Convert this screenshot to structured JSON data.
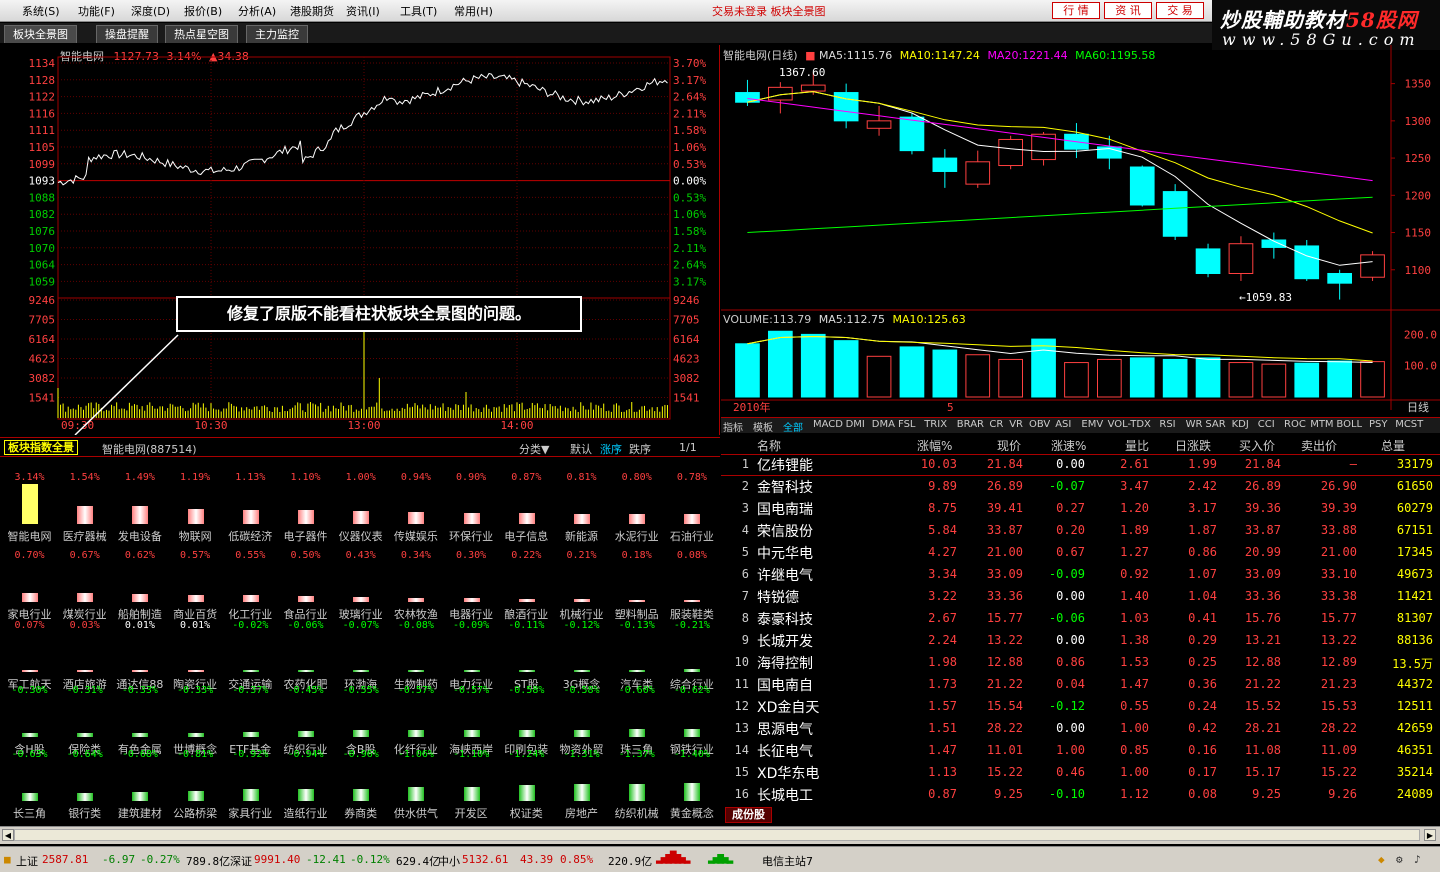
{
  "menu": {
    "items": [
      "系统(S)",
      "功能(F)",
      "深度(D)",
      "报价(B)",
      "分析(A)",
      "港股期货",
      "资讯(I)",
      "工具(T)",
      "常用(H)"
    ],
    "status_text": "交易未登录  板块全景图",
    "right_buttons": [
      "行 情",
      "资 讯",
      "交 易"
    ]
  },
  "logo": {
    "line1_a": "炒股輔助教材",
    "line1_b": "58",
    "line1_c": "股网",
    "line2": "www.58Gu.com"
  },
  "tabs": [
    "板块全景图",
    "操盘提醒",
    "热点星空图",
    "主力监控"
  ],
  "intraday": {
    "title": "智能电网",
    "price": "1127.73",
    "pct": "3.14%",
    "change": "▲34.38",
    "price_labels": [
      "1134",
      "1128",
      "1122",
      "1116",
      "1111",
      "1105",
      "1099",
      "1093",
      "1088",
      "1082",
      "1076",
      "1070",
      "1064",
      "1059"
    ],
    "pct_labels": [
      "3.70%",
      "3.17%",
      "2.64%",
      "2.11%",
      "1.58%",
      "1.06%",
      "0.53%",
      "0.00%",
      "0.53%",
      "1.06%",
      "1.58%",
      "2.11%",
      "2.64%",
      "3.17%"
    ],
    "vol_labels": [
      "9246",
      "7705",
      "6164",
      "4623",
      "3082",
      "1541"
    ],
    "time_labels": [
      "09:30",
      "10:30",
      "13:00",
      "14:00"
    ]
  },
  "callout": "修复了原版不能看柱状板块全景图的问题。",
  "kline": {
    "title": "智能电网(日线)",
    "ma5": "MA5:1115.76",
    "ma10": "MA10:1147.24",
    "ma20": "MA20:1221.44",
    "ma60": "MA60:1195.58",
    "high_label": "1367.60",
    "low_label": "←1059.83",
    "price_axis": [
      "1350",
      "1300",
      "1250",
      "1200",
      "1150",
      "1100"
    ],
    "vol_title": "VOLUME:113.79",
    "vol_ma5": "MA5:112.75",
    "vol_ma10": "MA10:125.63",
    "vol_axis": [
      "200.0",
      "100.0"
    ],
    "date_label": "2010年",
    "date_mark": "5",
    "period": "日线",
    "candles": [
      {
        "o": 1338,
        "h": 1355,
        "l": 1320,
        "c": 1325
      },
      {
        "o": 1328,
        "h": 1352,
        "l": 1310,
        "c": 1345
      },
      {
        "o": 1340,
        "h": 1365,
        "l": 1335,
        "c": 1348
      },
      {
        "o": 1338,
        "h": 1350,
        "l": 1290,
        "c": 1300
      },
      {
        "o": 1290,
        "h": 1320,
        "l": 1280,
        "c": 1300
      },
      {
        "o": 1305,
        "h": 1310,
        "l": 1255,
        "c": 1260
      },
      {
        "o": 1250,
        "h": 1262,
        "l": 1210,
        "c": 1232
      },
      {
        "o": 1215,
        "h": 1260,
        "l": 1210,
        "c": 1245
      },
      {
        "o": 1240,
        "h": 1280,
        "l": 1235,
        "c": 1275
      },
      {
        "o": 1248,
        "h": 1285,
        "l": 1240,
        "c": 1282
      },
      {
        "o": 1282,
        "h": 1297,
        "l": 1250,
        "c": 1262
      },
      {
        "o": 1265,
        "h": 1280,
        "l": 1235,
        "c": 1250
      },
      {
        "o": 1238,
        "h": 1240,
        "l": 1185,
        "c": 1187
      },
      {
        "o": 1205,
        "h": 1215,
        "l": 1140,
        "c": 1145
      },
      {
        "o": 1128,
        "h": 1135,
        "l": 1090,
        "c": 1095
      },
      {
        "o": 1095,
        "h": 1145,
        "l": 1085,
        "c": 1135
      },
      {
        "o": 1140,
        "h": 1150,
        "l": 1115,
        "c": 1130
      },
      {
        "o": 1132,
        "h": 1140,
        "l": 1085,
        "c": 1088
      },
      {
        "o": 1095,
        "h": 1100,
        "l": 1060,
        "c": 1082
      },
      {
        "o": 1090,
        "h": 1125,
        "l": 1085,
        "c": 1120
      }
    ],
    "volumes": [
      {
        "v": 170,
        "up": false
      },
      {
        "v": 210,
        "up": false
      },
      {
        "v": 200,
        "up": false
      },
      {
        "v": 180,
        "up": false
      },
      {
        "v": 130,
        "up": true
      },
      {
        "v": 160,
        "up": false
      },
      {
        "v": 150,
        "up": false
      },
      {
        "v": 135,
        "up": true
      },
      {
        "v": 120,
        "up": true
      },
      {
        "v": 185,
        "up": false
      },
      {
        "v": 110,
        "up": true
      },
      {
        "v": 120,
        "up": true
      },
      {
        "v": 125,
        "up": false
      },
      {
        "v": 120,
        "up": false
      },
      {
        "v": 125,
        "up": false
      },
      {
        "v": 110,
        "up": true
      },
      {
        "v": 105,
        "up": true
      },
      {
        "v": 108,
        "up": false
      },
      {
        "v": 115,
        "up": false
      },
      {
        "v": 113,
        "up": true
      }
    ]
  },
  "sector_header": {
    "tag": "板块指数全景",
    "name": "智能电网(887514)",
    "sort_menu": "分类▼",
    "opt_default": "默认",
    "opt_up": "涨序",
    "opt_down": "跌序",
    "page": "1/1"
  },
  "sectors": [
    [
      {
        "n": "智能电网",
        "p": "3.14%",
        "v": 3.14
      },
      {
        "n": "医疗器械",
        "p": "1.54%",
        "v": 1.54
      },
      {
        "n": "发电设备",
        "p": "1.49%",
        "v": 1.49
      },
      {
        "n": "物联网",
        "p": "1.19%",
        "v": 1.19
      },
      {
        "n": "低碳经济",
        "p": "1.13%",
        "v": 1.13
      },
      {
        "n": "电子器件",
        "p": "1.10%",
        "v": 1.1
      },
      {
        "n": "仪器仪表",
        "p": "1.00%",
        "v": 1.0
      },
      {
        "n": "传媒娱乐",
        "p": "0.94%",
        "v": 0.94
      },
      {
        "n": "环保行业",
        "p": "0.90%",
        "v": 0.9
      },
      {
        "n": "电子信息",
        "p": "0.87%",
        "v": 0.87
      },
      {
        "n": "新能源",
        "p": "0.81%",
        "v": 0.81
      },
      {
        "n": "水泥行业",
        "p": "0.80%",
        "v": 0.8
      },
      {
        "n": "石油行业",
        "p": "0.78%",
        "v": 0.78
      }
    ],
    [
      {
        "n": "家电行业",
        "p": "0.70%",
        "v": 0.7
      },
      {
        "n": "煤炭行业",
        "p": "0.67%",
        "v": 0.67
      },
      {
        "n": "船舶制造",
        "p": "0.62%",
        "v": 0.62
      },
      {
        "n": "商业百货",
        "p": "0.57%",
        "v": 0.57
      },
      {
        "n": "化工行业",
        "p": "0.55%",
        "v": 0.55
      },
      {
        "n": "食品行业",
        "p": "0.50%",
        "v": 0.5
      },
      {
        "n": "玻璃行业",
        "p": "0.43%",
        "v": 0.43
      },
      {
        "n": "农林牧渔",
        "p": "0.34%",
        "v": 0.34
      },
      {
        "n": "电器行业",
        "p": "0.30%",
        "v": 0.3
      },
      {
        "n": "酿酒行业",
        "p": "0.22%",
        "v": 0.22
      },
      {
        "n": "机械行业",
        "p": "0.21%",
        "v": 0.21
      },
      {
        "n": "塑料制品",
        "p": "0.18%",
        "v": 0.18
      },
      {
        "n": "服装鞋类",
        "p": "0.08%",
        "v": 0.08
      }
    ],
    [
      {
        "n": "军工航天",
        "p": "0.07%",
        "v": 0.07
      },
      {
        "n": "酒店旅游",
        "p": "0.03%",
        "v": 0.03
      },
      {
        "n": "通达信88",
        "p": "0.01%",
        "v": 0.01
      },
      {
        "n": "陶瓷行业",
        "p": "0.01%",
        "v": 0.01
      },
      {
        "n": "交通运输",
        "p": "-0.02%",
        "v": -0.02
      },
      {
        "n": "农药化肥",
        "p": "-0.06%",
        "v": -0.06
      },
      {
        "n": "环渤海",
        "p": "-0.07%",
        "v": -0.07
      },
      {
        "n": "生物制药",
        "p": "-0.08%",
        "v": -0.08
      },
      {
        "n": "电力行业",
        "p": "-0.09%",
        "v": -0.09
      },
      {
        "n": "ST股",
        "p": "-0.11%",
        "v": -0.11
      },
      {
        "n": "3G概念",
        "p": "-0.12%",
        "v": -0.12
      },
      {
        "n": "汽车类",
        "p": "-0.13%",
        "v": -0.13
      },
      {
        "n": "综合行业",
        "p": "-0.21%",
        "v": -0.21
      }
    ],
    [
      {
        "n": "含H股",
        "p": "-0.30%",
        "v": -0.3
      },
      {
        "n": "保险类",
        "p": "-0.31%",
        "v": -0.31
      },
      {
        "n": "有色金属",
        "p": "-0.33%",
        "v": -0.33
      },
      {
        "n": "世博概念",
        "p": "-0.33%",
        "v": -0.33
      },
      {
        "n": "ETF基金",
        "p": "-0.37%",
        "v": -0.37
      },
      {
        "n": "纺织行业",
        "p": "-0.45%",
        "v": -0.45
      },
      {
        "n": "含B股",
        "p": "-0.55%",
        "v": -0.55
      },
      {
        "n": "化纤行业",
        "p": "-0.57%",
        "v": -0.57
      },
      {
        "n": "海峡西岸",
        "p": "-0.57%",
        "v": -0.57
      },
      {
        "n": "印刷包装",
        "p": "-0.58%",
        "v": -0.58
      },
      {
        "n": "物资外贸",
        "p": "-0.58%",
        "v": -0.58
      },
      {
        "n": "珠三角",
        "p": "-0.60%",
        "v": -0.6
      },
      {
        "n": "钢铁行业",
        "p": "-0.62%",
        "v": -0.62
      }
    ],
    [
      {
        "n": "长三角",
        "p": "-0.63%",
        "v": -0.63
      },
      {
        "n": "银行类",
        "p": "-0.64%",
        "v": -0.64
      },
      {
        "n": "建筑建材",
        "p": "-0.68%",
        "v": -0.68
      },
      {
        "n": "公路桥梁",
        "p": "-0.81%",
        "v": -0.81
      },
      {
        "n": "家具行业",
        "p": "-0.92%",
        "v": -0.92
      },
      {
        "n": "造纸行业",
        "p": "-0.94%",
        "v": -0.94
      },
      {
        "n": "券商类",
        "p": "-0.96%",
        "v": -0.96
      },
      {
        "n": "供水供气",
        "p": "-1.06%",
        "v": -1.06
      },
      {
        "n": "开发区",
        "p": "-1.10%",
        "v": -1.1
      },
      {
        "n": "权证类",
        "p": "-1.24%",
        "v": -1.24
      },
      {
        "n": "房地产",
        "p": "-1.31%",
        "v": -1.31
      },
      {
        "n": "纺织机械",
        "p": "-1.37%",
        "v": -1.37
      },
      {
        "n": "黄金概念",
        "p": "-1.40%",
        "v": -1.4
      }
    ]
  ],
  "indicator_tabs": [
    "指标",
    "模板",
    "全部",
    "MACD",
    "DMI",
    "DMA",
    "FSL",
    "TRIX",
    "BRAR",
    "CR",
    "VR",
    "OBV",
    "ASI",
    "EMV",
    "VOL-TDX",
    "RSI",
    "WR",
    "SAR",
    "KDJ",
    "CCI",
    "ROC",
    "MTM",
    "BOLL",
    "PSY",
    "MCST"
  ],
  "table": {
    "headers": [
      "名称",
      "涨幅%",
      "现价",
      "涨速%",
      "量比",
      "日涨跌",
      "买入价",
      "卖出价",
      "总量"
    ],
    "rows": [
      [
        "1",
        "亿纬锂能",
        "10.03",
        "21.84",
        "0.00",
        "2.61",
        "1.99",
        "21.84",
        "—",
        "33179"
      ],
      [
        "2",
        "金智科技",
        "9.89",
        "26.89",
        "-0.07",
        "3.47",
        "2.42",
        "26.89",
        "26.90",
        "61650"
      ],
      [
        "3",
        "国电南瑞",
        "8.75",
        "39.41",
        "0.27",
        "1.20",
        "3.17",
        "39.36",
        "39.39",
        "60279"
      ],
      [
        "4",
        "荣信股份",
        "5.84",
        "33.87",
        "0.20",
        "1.89",
        "1.87",
        "33.87",
        "33.88",
        "67151"
      ],
      [
        "5",
        "中元华电",
        "4.27",
        "21.00",
        "0.67",
        "1.27",
        "0.86",
        "20.99",
        "21.00",
        "17345"
      ],
      [
        "6",
        "许继电气",
        "3.34",
        "33.09",
        "-0.09",
        "0.92",
        "1.07",
        "33.09",
        "33.10",
        "49673"
      ],
      [
        "7",
        "特锐德",
        "3.22",
        "33.36",
        "0.00",
        "1.40",
        "1.04",
        "33.36",
        "33.38",
        "11421"
      ],
      [
        "8",
        "泰豪科技",
        "2.67",
        "15.77",
        "-0.06",
        "1.03",
        "0.41",
        "15.76",
        "15.77",
        "81307"
      ],
      [
        "9",
        "长城开发",
        "2.24",
        "13.22",
        "0.00",
        "1.38",
        "0.29",
        "13.21",
        "13.22",
        "88136"
      ],
      [
        "10",
        "海得控制",
        "1.98",
        "12.88",
        "0.86",
        "1.53",
        "0.25",
        "12.88",
        "12.89",
        "13.5万"
      ],
      [
        "11",
        "国电南自",
        "1.73",
        "21.22",
        "0.04",
        "1.47",
        "0.36",
        "21.22",
        "21.23",
        "44372"
      ],
      [
        "12",
        "XD金自天",
        "1.57",
        "15.54",
        "-0.12",
        "0.55",
        "0.24",
        "15.52",
        "15.53",
        "12511"
      ],
      [
        "13",
        "思源电气",
        "1.51",
        "28.22",
        "0.00",
        "1.00",
        "0.42",
        "28.21",
        "28.22",
        "42659"
      ],
      [
        "14",
        "长征电气",
        "1.47",
        "11.01",
        "1.00",
        "0.85",
        "0.16",
        "11.08",
        "11.09",
        "46351"
      ],
      [
        "15",
        "XD华东电",
        "1.13",
        "15.22",
        "0.46",
        "1.00",
        "0.17",
        "15.17",
        "15.22",
        "35214"
      ],
      [
        "16",
        "长城电工",
        "0.87",
        "9.25",
        "-0.10",
        "1.12",
        "0.08",
        "9.25",
        "9.26",
        "24089"
      ]
    ],
    "footer_tab": "成份股"
  },
  "statusbar": {
    "sh_label": "上证",
    "sh_val": "2587.81",
    "sh_chg": "-6.97",
    "sh_pct": "-0.27%",
    "sh_amt": "789.8亿",
    "sz_label": "深证",
    "sz_val": "9991.40",
    "sz_chg": "-12.41",
    "sz_pct": "-0.12%",
    "sz_amt": "629.4亿",
    "zx_label": "中小",
    "zx_val": "5132.61",
    "zx_chg": "43.39",
    "zx_pct": "0.85%",
    "zx_amt": "220.9亿",
    "server": "电信主站7"
  },
  "colors": {
    "up": "#ff4040",
    "down": "#00ffff",
    "flat": "#ffffff",
    "accent": "#a00000",
    "yellow": "#ffff00"
  }
}
